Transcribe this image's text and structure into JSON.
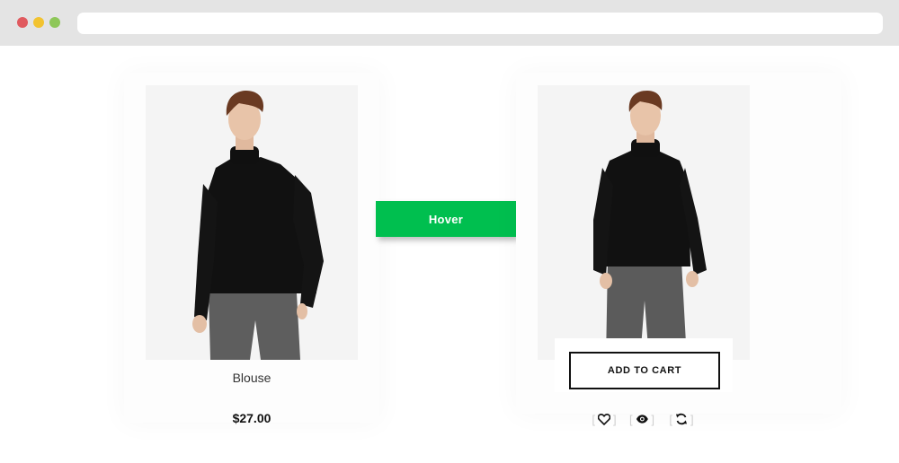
{
  "browser": {
    "traffic_lights": [
      "close",
      "minimize",
      "maximize"
    ],
    "colors": {
      "close": "#e05a5f",
      "minimize": "#f2c330",
      "maximize": "#8ec759"
    }
  },
  "product": {
    "title": "Blouse",
    "price": "$27.00"
  },
  "hover": {
    "label": "Hover",
    "color": "#00bf4f"
  },
  "hover_state": {
    "add_to_cart_label": "ADD TO CART",
    "actions": [
      {
        "name": "wishlist",
        "icon": "heart-icon"
      },
      {
        "name": "quick-view",
        "icon": "eye-icon"
      },
      {
        "name": "compare",
        "icon": "refresh-icon"
      }
    ]
  }
}
